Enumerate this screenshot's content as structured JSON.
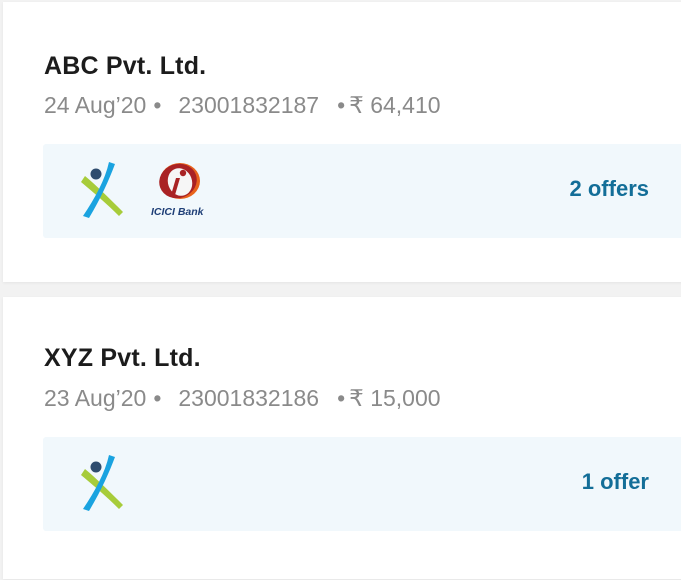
{
  "transactions": [
    {
      "company": "ABC Pvt. Ltd.",
      "date": "24 Aug’20",
      "separator": "•",
      "invoice_number": "23001832187",
      "amount": "₹ 64,410",
      "lender_logos": [
        "x-lender-logo",
        "icici-bank-logo"
      ],
      "icici_text": "ICICI Bank",
      "offers_label": "2 offers"
    },
    {
      "company": "XYZ Pvt. Ltd.",
      "date": "23 Aug’20",
      "separator": "•",
      "invoice_number": "23001832186",
      "amount": "₹ 15,000",
      "lender_logos": [
        "x-lender-logo"
      ],
      "offers_label": "1 offer"
    }
  ],
  "colors": {
    "accent": "#136e98",
    "strip_background": "#f1f8fc",
    "muted_text": "#8a8a8a",
    "heading_text": "#1c1c1c",
    "page_background": "#f2f2f2"
  }
}
